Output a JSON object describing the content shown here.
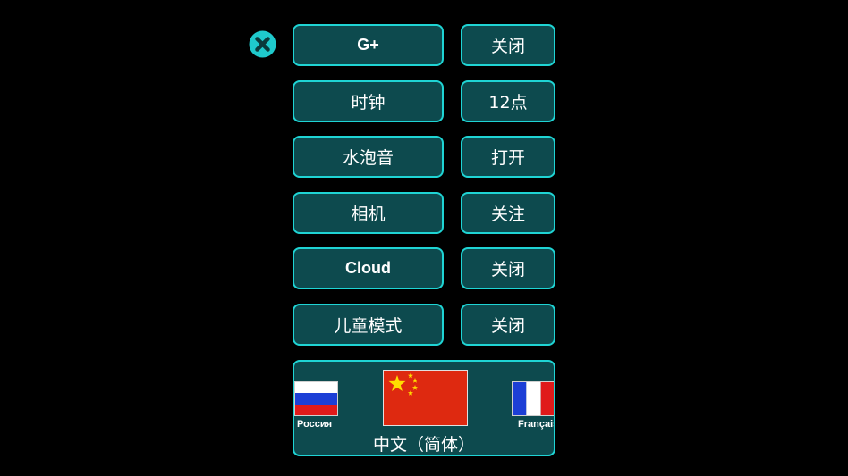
{
  "settings": {
    "rows": [
      {
        "name": "G+",
        "value": "关闭"
      },
      {
        "name": "时钟",
        "value": "12点"
      },
      {
        "name": "水泡音",
        "value": "打开"
      },
      {
        "name": "相机",
        "value": "关注"
      },
      {
        "name": "Cloud",
        "value": "关闭"
      },
      {
        "name": "儿童模式",
        "value": "关闭"
      }
    ]
  },
  "language": {
    "current": "中文（简体）",
    "prev_label": "Россия",
    "next_label": "Français"
  },
  "colors": {
    "background": "#000000",
    "button_fill": "#0d4a4e",
    "button_border": "#1fd4d4",
    "text": "#ffffff"
  },
  "icons": {
    "close": "close-icon",
    "prev_flag": "russia-flag-icon",
    "current_flag": "china-flag-icon",
    "next_flag": "france-flag-icon"
  }
}
